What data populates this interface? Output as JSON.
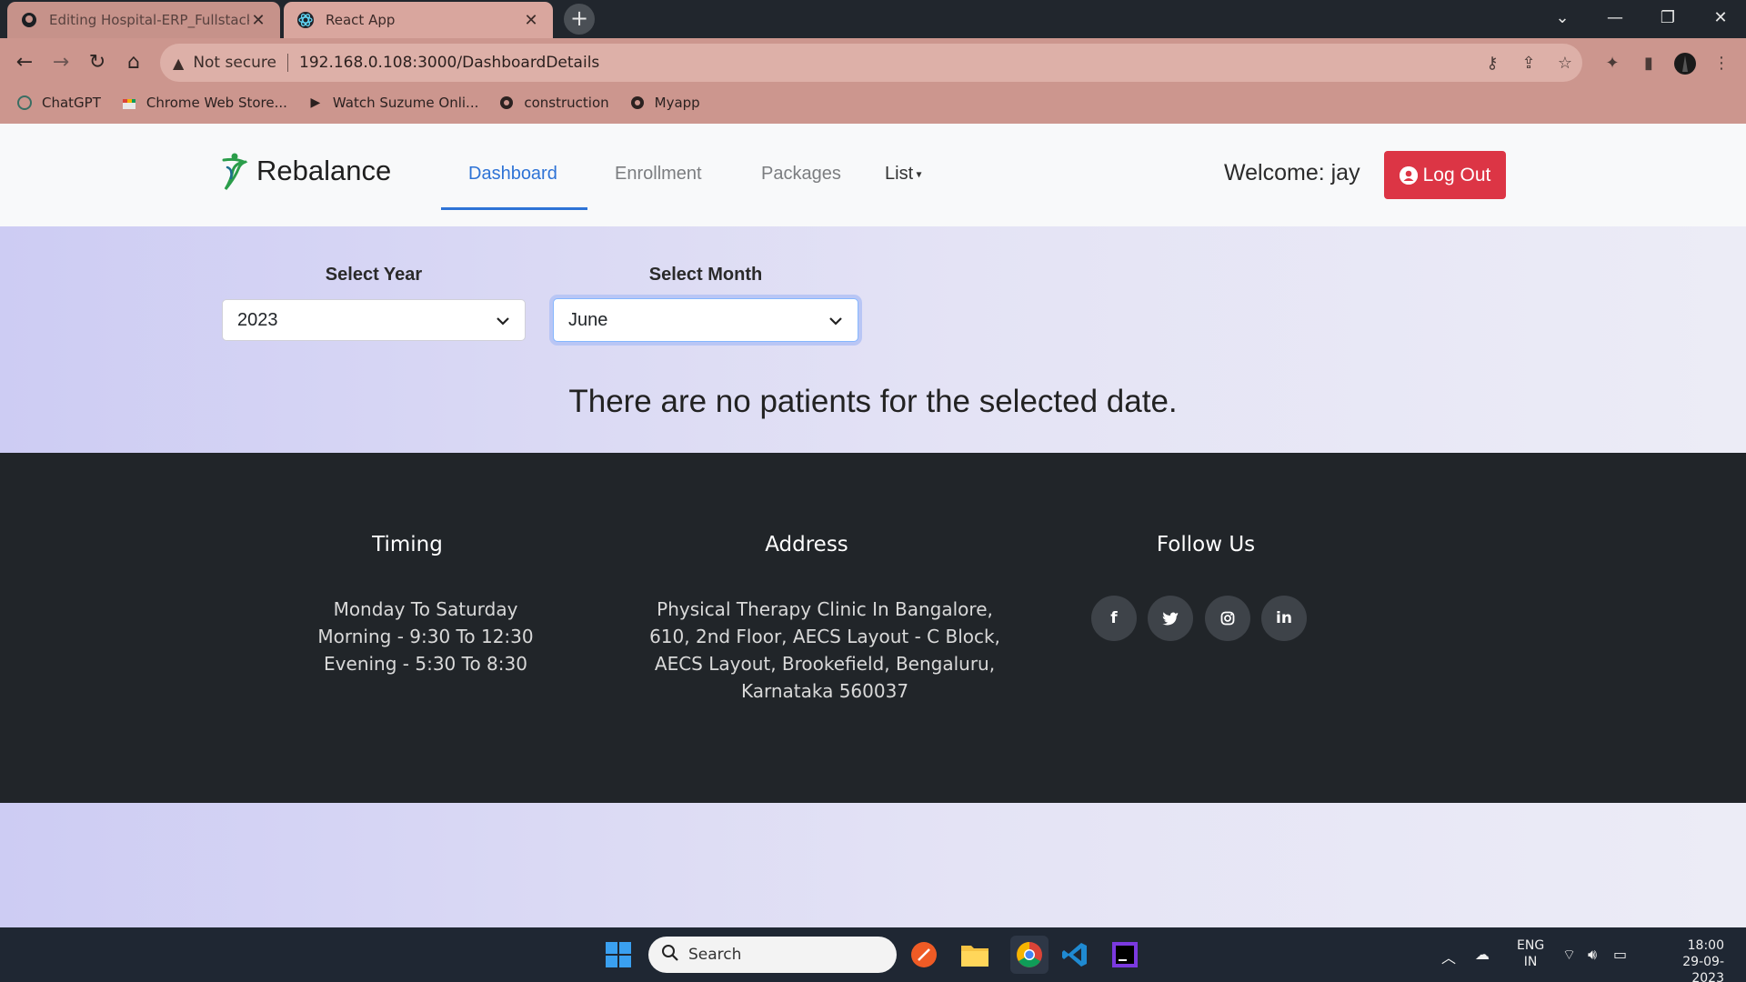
{
  "browser": {
    "tabs": [
      {
        "label": "Editing Hospital-ERP_Fullstack/R",
        "active": false
      },
      {
        "label": "React App",
        "active": true
      }
    ],
    "omnibox": {
      "security": "Not secure",
      "url": "192.168.0.108:3000/DashboardDetails"
    },
    "bookmarks": [
      {
        "label": "ChatGPT",
        "icon": "chatgpt-icon"
      },
      {
        "label": "Chrome Web Store...",
        "icon": "chrome-web-store-icon"
      },
      {
        "label": "Watch Suzume Onli...",
        "icon": "play-icon"
      },
      {
        "label": "construction",
        "icon": "globe-icon"
      },
      {
        "label": "Myapp",
        "icon": "globe-icon"
      }
    ]
  },
  "app": {
    "brand": "Rebalance",
    "nav": [
      {
        "label": "Dashboard",
        "active": true
      },
      {
        "label": "Enrollment",
        "active": false
      },
      {
        "label": "Packages",
        "active": false
      },
      {
        "label": "List",
        "active": false
      }
    ],
    "welcome": "Welcome: jay",
    "logout_label": "Log Out",
    "filters": {
      "year_label": "Select Year",
      "year_value": "2023",
      "month_label": "Select Month",
      "month_value": "June"
    },
    "message": "There are no patients for the selected date.",
    "footer": {
      "timing": {
        "title": "Timing",
        "lines": [
          "Monday To Saturday",
          "Morning - 9:30 To 12:30",
          "Evening - 5:30 To 8:30"
        ]
      },
      "address": {
        "title": "Address",
        "lines": [
          "Physical Therapy Clinic In Bangalore,",
          "610, 2nd Floor, AECS Layout - C Block,",
          "AECS Layout, Brookefield, Bengaluru,",
          "Karnataka 560037"
        ]
      },
      "follow": {
        "title": "Follow Us",
        "socials": [
          {
            "name": "facebook-icon",
            "glyph": "f"
          },
          {
            "name": "twitter-icon",
            "glyph": "🐦"
          },
          {
            "name": "instagram-icon",
            "glyph": "◎"
          },
          {
            "name": "linkedin-icon",
            "glyph": "in"
          }
        ]
      }
    }
  },
  "taskbar": {
    "search_placeholder": "Search",
    "lang": "ENG",
    "region": "IN",
    "time": "18:00",
    "date": "29-09-2023"
  },
  "colors": {
    "accent": "#2e73d6",
    "danger": "#dc3545",
    "footer_bg": "#212529",
    "browser_theme": "#cc968e"
  }
}
